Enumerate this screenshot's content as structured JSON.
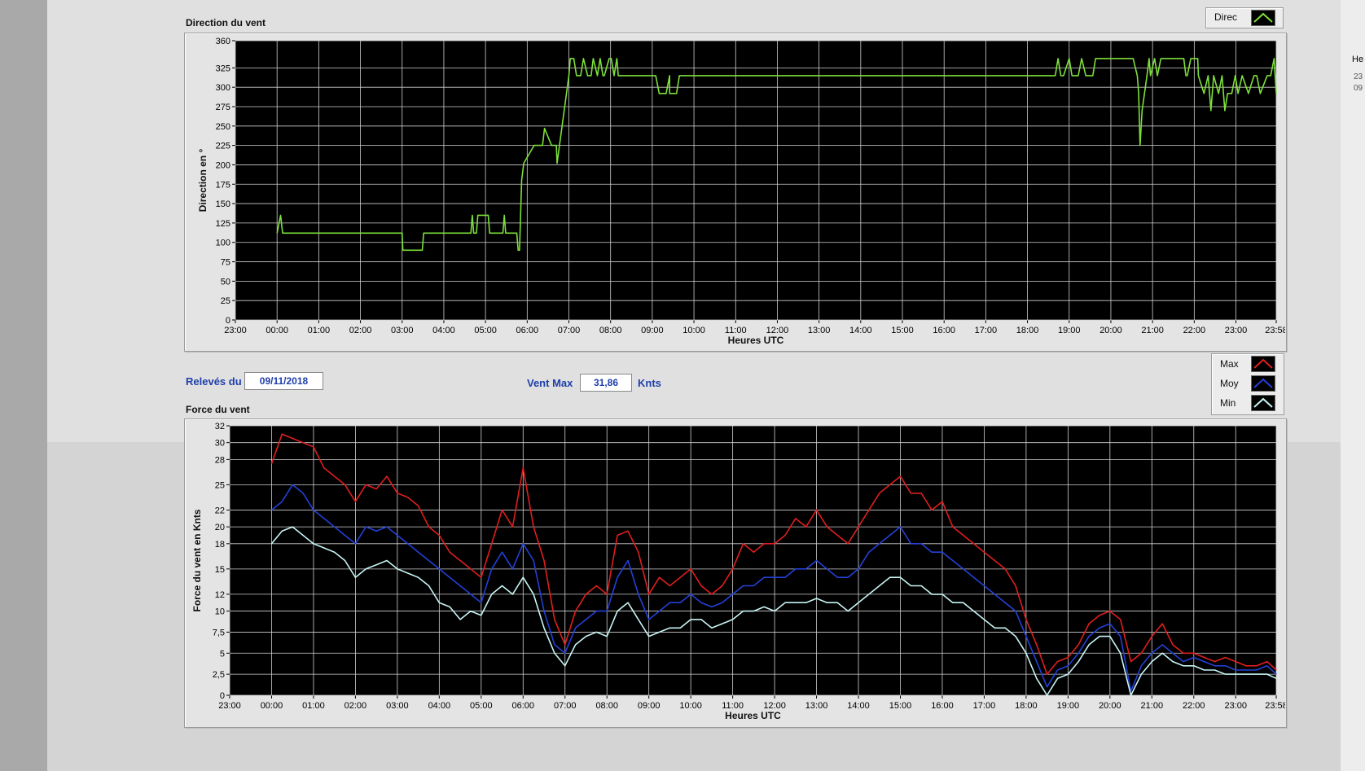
{
  "window": {
    "edge_label": "He",
    "edge_value_1": "23",
    "edge_value_2": "09"
  },
  "direction_chart": {
    "title": "Direction du vent",
    "legend": [
      {
        "label": "Direc",
        "color": "#7de03a"
      }
    ]
  },
  "readings": {
    "date_label": "Relevés du",
    "date_value": "09/11/2018",
    "max_label": "Vent Max",
    "max_value": "31,86",
    "max_unit": "Knts"
  },
  "force_chart": {
    "title": "Force du vent",
    "legend": [
      {
        "label": "Max",
        "color": "#e01e1e"
      },
      {
        "label": "Moy",
        "color": "#2440d8"
      },
      {
        "label": "Min",
        "color": "#c8f4f4"
      }
    ]
  },
  "chart_data": [
    {
      "type": "line",
      "title": "Direction du vent",
      "xlabel": "Heures UTC",
      "ylabel": "Direction en °",
      "xlim": [
        "23:00",
        "23:58"
      ],
      "x_ticks": [
        "23:00",
        "00:00",
        "01:00",
        "02:00",
        "03:00",
        "04:00",
        "05:00",
        "06:00",
        "07:00",
        "08:00",
        "09:00",
        "10:00",
        "11:00",
        "12:00",
        "13:00",
        "14:00",
        "15:00",
        "16:00",
        "17:00",
        "18:00",
        "19:00",
        "20:00",
        "21:00",
        "22:00",
        "23:00",
        "23:58"
      ],
      "ylim": [
        0,
        360
      ],
      "y_ticks": [
        "0",
        "25",
        "50",
        "75",
        "100",
        "125",
        "150",
        "175",
        "200",
        "225",
        "250",
        "275",
        "300",
        "325",
        "360"
      ],
      "grid": true,
      "legend_position": "top-right",
      "series": [
        {
          "name": "Direc",
          "color": "#7de03a",
          "x": [
            "00:00",
            "00:05",
            "00:08",
            "00:11",
            "03:00",
            "03:01",
            "03:29",
            "03:31",
            "04:39",
            "04:41",
            "04:43",
            "04:45",
            "04:47",
            "04:49",
            "04:51",
            "05:04",
            "05:06",
            "05:25",
            "05:27",
            "05:29",
            "05:32",
            "05:44",
            "05:45",
            "05:47",
            "05:49",
            "05:52",
            "05:55",
            "06:10",
            "06:22",
            "06:25",
            "06:35",
            "06:42",
            "06:43",
            "07:00",
            "07:02",
            "07:07",
            "07:11",
            "07:17",
            "07:21",
            "07:27",
            "07:32",
            "07:35",
            "07:41",
            "07:45",
            "07:49",
            "07:51",
            "07:58",
            "08:01",
            "08:05",
            "08:09",
            "08:11",
            "08:17",
            "09:05",
            "09:10",
            "09:20",
            "09:25",
            "09:25",
            "09:35",
            "09:39",
            "09:49",
            "09:50",
            "18:40",
            "18:44",
            "18:48",
            "18:52",
            "19:00",
            "19:04",
            "19:13",
            "19:18",
            "19:24",
            "19:34",
            "19:38",
            "20:32",
            "20:38",
            "20:40",
            "20:42",
            "20:45",
            "20:52",
            "20:55",
            "20:57",
            "21:03",
            "21:07",
            "21:12",
            "21:18",
            "21:45",
            "21:48",
            "21:50",
            "21:55",
            "22:00",
            "22:05",
            "22:06",
            "22:14",
            "22:20",
            "22:24",
            "22:28",
            "22:35",
            "22:40",
            "22:44",
            "22:48",
            "22:54",
            "22:59",
            "23:03",
            "23:09",
            "23:18",
            "23:26",
            "23:30",
            "23:35",
            "23:45",
            "23:50",
            "23:55",
            "23:58"
          ],
          "y": [
            112,
            135,
            112,
            112,
            112,
            90,
            90,
            112,
            112,
            135,
            112,
            112,
            112,
            135,
            135,
            135,
            112,
            112,
            135,
            112,
            112,
            112,
            112,
            90,
            90,
            180,
            202,
            225,
            225,
            247,
            225,
            225,
            202,
            315,
            337,
            337,
            315,
            315,
            337,
            315,
            315,
            337,
            315,
            337,
            315,
            315,
            337,
            337,
            315,
            337,
            315,
            315,
            315,
            292,
            292,
            315,
            292,
            292,
            315,
            315,
            315,
            315,
            337,
            315,
            315,
            337,
            315,
            315,
            337,
            315,
            315,
            337,
            337,
            315,
            292,
            225,
            270,
            315,
            337,
            315,
            337,
            315,
            337,
            337,
            337,
            315,
            315,
            337,
            337,
            337,
            315,
            292,
            315,
            270,
            315,
            292,
            315,
            270,
            292,
            292,
            315,
            292,
            315,
            292,
            315,
            315,
            292,
            315,
            315,
            337,
            292
          ]
        }
      ]
    },
    {
      "type": "line",
      "title": "Force du vent",
      "xlabel": "Heures UTC",
      "ylabel": "Force du vent en Knts",
      "xlim": [
        "23:00",
        "23:58"
      ],
      "x_ticks": [
        "23:00",
        "00:00",
        "01:00",
        "02:00",
        "03:00",
        "04:00",
        "05:00",
        "06:00",
        "07:00",
        "08:00",
        "09:00",
        "10:00",
        "11:00",
        "12:00",
        "13:00",
        "14:00",
        "15:00",
        "16:00",
        "17:00",
        "18:00",
        "19:00",
        "20:00",
        "21:00",
        "22:00",
        "23:00",
        "23:58"
      ],
      "ylim": [
        0,
        32
      ],
      "y_ticks": [
        "0",
        "2,5",
        "5",
        "7,5",
        "10",
        "12",
        "15",
        "18",
        "20",
        "22",
        "25",
        "28",
        "30",
        "32"
      ],
      "grid": true,
      "legend_position": "top-right",
      "x_hours": [
        0,
        0.25,
        0.5,
        0.75,
        1,
        1.25,
        1.5,
        1.75,
        2,
        2.25,
        2.5,
        2.75,
        3,
        3.25,
        3.5,
        3.75,
        4,
        4.25,
        4.5,
        4.75,
        5,
        5.25,
        5.5,
        5.75,
        6,
        6.25,
        6.5,
        6.75,
        7,
        7.25,
        7.5,
        7.75,
        8,
        8.25,
        8.5,
        8.75,
        9,
        9.25,
        9.5,
        9.75,
        10,
        10.25,
        10.5,
        10.75,
        11,
        11.25,
        11.5,
        11.75,
        12,
        12.25,
        12.5,
        12.75,
        13,
        13.25,
        13.5,
        13.75,
        14,
        14.25,
        14.5,
        14.75,
        15,
        15.25,
        15.5,
        15.75,
        16,
        16.25,
        16.5,
        16.75,
        17,
        17.25,
        17.5,
        17.75,
        18,
        18.25,
        18.5,
        18.75,
        19,
        19.25,
        19.5,
        19.75,
        20,
        20.25,
        20.5,
        20.75,
        21,
        21.25,
        21.5,
        21.75,
        22,
        22.25,
        22.5,
        22.75,
        23,
        23.25,
        23.5,
        23.75,
        23.97
      ],
      "series": [
        {
          "name": "Max",
          "color": "#e01e1e",
          "values": [
            27.5,
            31,
            30.5,
            30,
            29.5,
            27,
            26,
            25,
            23,
            25,
            24.5,
            26,
            24,
            23.5,
            22.5,
            20,
            19,
            17,
            16,
            15,
            14,
            18,
            22,
            20,
            27,
            20,
            16,
            9,
            6,
            10,
            12,
            13,
            12,
            19,
            19.5,
            17,
            12,
            14,
            13,
            14,
            15,
            13,
            12,
            13,
            15,
            18,
            17,
            18,
            18,
            19,
            21,
            20,
            22,
            20,
            19,
            18,
            20,
            22,
            24,
            25,
            26,
            24,
            24,
            22,
            23,
            20,
            19,
            18,
            17,
            16,
            15,
            13,
            9,
            6,
            2.5,
            4,
            4.5,
            6,
            8.5,
            9.5,
            10,
            9,
            4,
            5,
            7,
            8.5,
            6,
            5,
            5,
            4.5,
            4,
            4.5,
            4,
            3.5,
            3.5,
            4,
            3,
            0.5
          ]
        },
        {
          "name": "Moy",
          "color": "#2440d8",
          "values": [
            22,
            23,
            25,
            24,
            22,
            21,
            20,
            19,
            18,
            20,
            19.5,
            20,
            19,
            18,
            17,
            16,
            15,
            14,
            13,
            12,
            11,
            15,
            17,
            15,
            18,
            16,
            10,
            6,
            5,
            8,
            9,
            10,
            10,
            14,
            16,
            12,
            9,
            10,
            11,
            11,
            12,
            11,
            10.5,
            11,
            12,
            13,
            13,
            14,
            14,
            14,
            15,
            15,
            16,
            15,
            14,
            14,
            15,
            17,
            18,
            19,
            20,
            18,
            18,
            17,
            17,
            16,
            15,
            14,
            13,
            12,
            11,
            10,
            7,
            4,
            1,
            3,
            3.5,
            5,
            7,
            8,
            8.5,
            7,
            0.5,
            3.5,
            5,
            6,
            5,
            4,
            4.5,
            4,
            3.5,
            3.5,
            3,
            3,
            3,
            3.5,
            2.5,
            0.3
          ]
        },
        {
          "name": "Min",
          "color": "#c8f4f4",
          "values": [
            18,
            19.5,
            20,
            19,
            18,
            17.5,
            17,
            16,
            14,
            15,
            15.5,
            16,
            15,
            14.5,
            14,
            13,
            11,
            10.5,
            9,
            10,
            9.5,
            12,
            13,
            12,
            14,
            12,
            8,
            5,
            3.5,
            6,
            7,
            7.5,
            7,
            10,
            11,
            9,
            7,
            7.5,
            8,
            8,
            9,
            9,
            8,
            8.5,
            9,
            10,
            10,
            10.5,
            10,
            11,
            11,
            11,
            11.5,
            11,
            11,
            10,
            11,
            12,
            13,
            14,
            14,
            13,
            13,
            12,
            12,
            11,
            11,
            10,
            9,
            8,
            8,
            7,
            5,
            2,
            0,
            2,
            2.5,
            4,
            6,
            7,
            7,
            5,
            0,
            2.5,
            4,
            5,
            4,
            3.5,
            3.5,
            3,
            3,
            2.5,
            2.5,
            2.5,
            2.5,
            2.5,
            2,
            0.2
          ]
        }
      ]
    }
  ]
}
